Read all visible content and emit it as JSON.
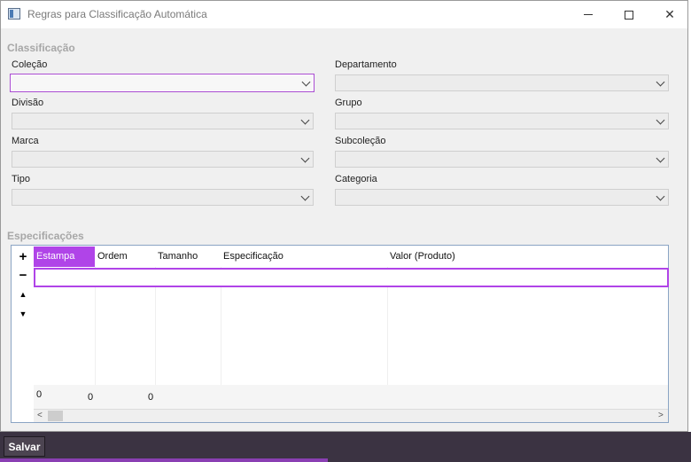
{
  "window": {
    "title": "Regras para Classificação Automática"
  },
  "classificacao": {
    "title": "Classificação",
    "fields": {
      "colecao": {
        "label": "Coleção",
        "value": ""
      },
      "departamento": {
        "label": "Departamento",
        "value": ""
      },
      "divisao": {
        "label": "Divisão",
        "value": ""
      },
      "grupo": {
        "label": "Grupo",
        "value": ""
      },
      "marca": {
        "label": "Marca",
        "value": ""
      },
      "subcolecao": {
        "label": "Subcoleção",
        "value": ""
      },
      "tipo": {
        "label": "Tipo",
        "value": ""
      },
      "categoria": {
        "label": "Categoria",
        "value": ""
      }
    }
  },
  "especificacoes": {
    "title": "Especificações",
    "tools": {
      "add": "+",
      "remove": "−",
      "up": "▲",
      "down": "▼"
    },
    "columns": [
      "Estampa",
      "Ordem",
      "Tamanho",
      "Especificação",
      "Valor (Produto)"
    ],
    "totals": [
      "0",
      "0",
      "0"
    ],
    "scroll": {
      "left": "<",
      "right": ">"
    }
  },
  "footer": {
    "save_label": "Salvar"
  },
  "colors": {
    "accent": "#b044e8",
    "statusbar": "#3b3342"
  }
}
